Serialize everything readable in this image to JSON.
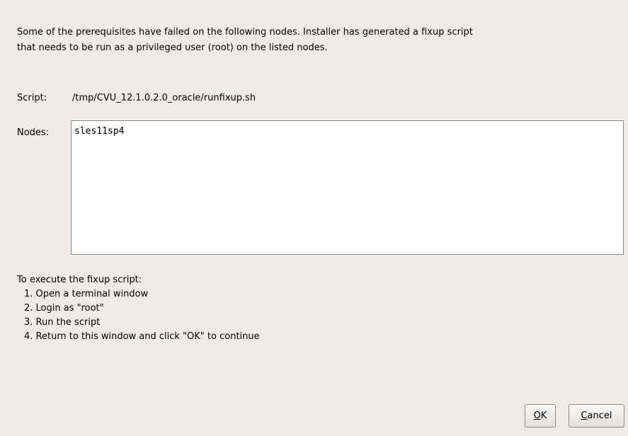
{
  "intro": {
    "line1": "Some of the prerequisites have failed on the following nodes. Installer has generated a fixup script",
    "line2": "that needs to be run as a privileged user (root) on the listed nodes."
  },
  "script": {
    "label": "Script:",
    "value": "/tmp/CVU_12.1.0.2.0_oracle/runfixup.sh"
  },
  "nodes": {
    "label": "Nodes:",
    "items": [
      "sles11sp4"
    ]
  },
  "instructions": {
    "title": "To execute the fixup script:",
    "steps": [
      "1. Open a terminal window",
      "2. Login as \"root\"",
      "3. Run the script",
      "4. Return to this window and click \"OK\" to continue"
    ]
  },
  "buttons": {
    "ok_mnemonic": "O",
    "ok_rest": "K",
    "cancel_mnemonic": "C",
    "cancel_rest": "ancel"
  }
}
